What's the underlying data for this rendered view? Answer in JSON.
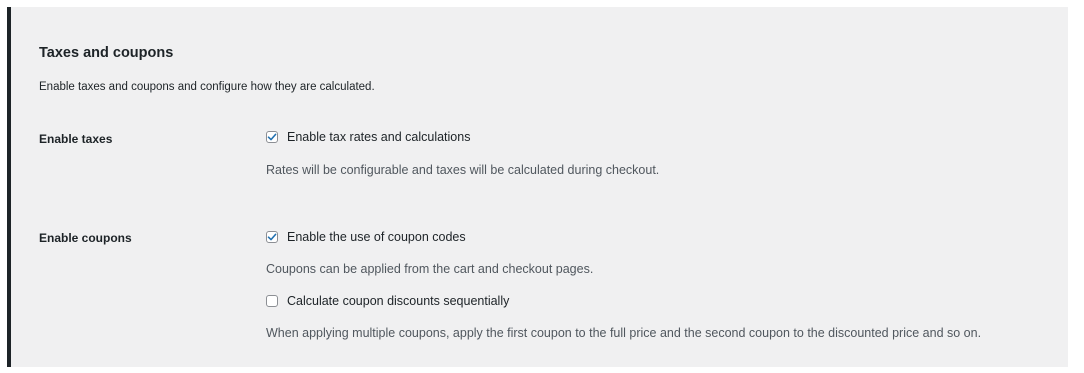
{
  "section": {
    "title": "Taxes and coupons",
    "description": "Enable taxes and coupons and configure how they are calculated."
  },
  "taxes": {
    "label": "Enable taxes",
    "checkbox_label": "Enable tax rates and calculations",
    "checked": true,
    "help": "Rates will be configurable and taxes will be calculated during checkout."
  },
  "coupons": {
    "label": "Enable coupons",
    "checkbox_label": "Enable the use of coupon codes",
    "checked": true,
    "help": "Coupons can be applied from the cart and checkout pages.",
    "sequential": {
      "checkbox_label": "Calculate coupon discounts sequentially",
      "checked": false,
      "help": "When applying multiple coupons, apply the first coupon to the full price and the second coupon to the discounted price and so on."
    }
  },
  "colors": {
    "accent": "#2271b1",
    "panel_bg": "#f0f0f1",
    "left_border": "#1d2327"
  },
  "icons": {
    "check": "check-icon"
  }
}
